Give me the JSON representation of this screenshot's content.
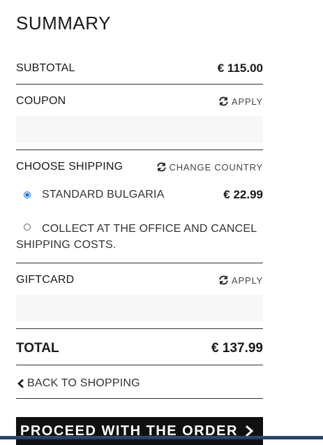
{
  "summary": {
    "title": "SUMMARY",
    "subtotal_label": "SUBTOTAL",
    "subtotal_value": "€ 115.00",
    "coupon_label": "COUPON",
    "coupon_apply": "APPLY",
    "coupon_value": "",
    "shipping_label": "CHOOSE SHIPPING",
    "change_country": "CHANGE COUNTRY",
    "shipping_options": [
      {
        "label": "STANDARD BULGARIA",
        "price": "€ 22.99",
        "selected": true
      },
      {
        "label": "COLLECT AT THE OFFICE AND CANCEL SHIPPING COSTS.",
        "price": "",
        "selected": false
      }
    ],
    "giftcard_label": "GIFTCARD",
    "giftcard_apply": "APPLY",
    "giftcard_value": "",
    "total_label": "TOTAL",
    "total_value": "€ 137.99",
    "back_label": "BACK TO SHOPPING",
    "proceed_label": "PROCEED WITH THE ORDER"
  },
  "icons": {
    "refresh": "refresh-icon",
    "chevron_left": "chevron-left-icon",
    "chevron_right": "chevron-right-icon"
  },
  "colors": {
    "radio_selected": "#1a73e8",
    "proceed_bg": "#111111",
    "input_bg": "#f7f7f7"
  }
}
